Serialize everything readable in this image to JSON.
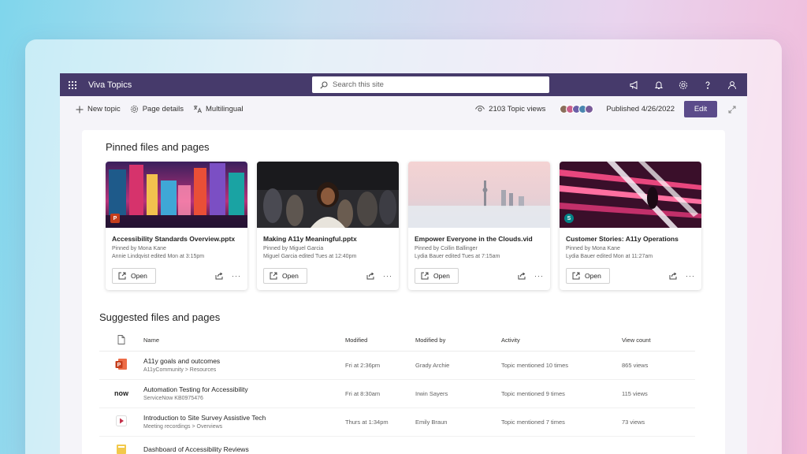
{
  "app": {
    "title": "Viva Topics"
  },
  "search": {
    "placeholder": "Search this site"
  },
  "commandbar": {
    "new_topic": "New topic",
    "page_details": "Page details",
    "multilingual": "Multilingual",
    "views": "2103 Topic views",
    "published": "Published 4/26/2022",
    "edit": "Edit"
  },
  "pinned": {
    "title": "Pinned files and pages",
    "cards": [
      {
        "title": "Accessibility Standards Overview.pptx",
        "pinned_by": "Pinned by Mona Kane",
        "edited": "Annie Lindqvist edited Mon at 3:15pm",
        "open": "Open",
        "badge": "P",
        "badge_color": "#c43e1c"
      },
      {
        "title": "Making A11y Meaningful.pptx",
        "pinned_by": "Pinned by Miguel Garcia",
        "edited": "Miguel Garcia edited Tues at 12:40pm",
        "open": "Open",
        "badge": "",
        "badge_color": ""
      },
      {
        "title": "Empower Everyone in the Clouds.vid",
        "pinned_by": "Pinned by Collin Ballinger",
        "edited": "Lydia Bauer edited Tues at 7:15am",
        "open": "Open",
        "badge": "",
        "badge_color": ""
      },
      {
        "title": "Customer Stories: A11y Operations",
        "pinned_by": "Pinned by Mona Kane",
        "edited": "Lydia Bauer edited Mon at 11:27am",
        "open": "Open",
        "badge": "S",
        "badge_color": "#038387"
      }
    ]
  },
  "suggested": {
    "title": "Suggested files and pages",
    "columns": {
      "name": "Name",
      "modified": "Modified",
      "modified_by": "Modified by",
      "activity": "Activity",
      "view_count": "View count"
    },
    "rows": [
      {
        "icon": "powerpoint-icon",
        "name": "A11y goals and outcomes",
        "path": "A11yCommunity > Resources",
        "modified": "Fri at 2:36pm",
        "modified_by": "Grady Archie",
        "activity": "Topic mentioned 10 times",
        "views": "865 views"
      },
      {
        "icon": "servicenow-icon",
        "icon_text": "now",
        "name": "Automation Testing for Accessibility",
        "path": "ServiceNow KB0975476",
        "modified": "Fri at 8:30am",
        "modified_by": "Irwin Sayers",
        "activity": "Topic mentioned 9 times",
        "views": "115 views"
      },
      {
        "icon": "video-icon",
        "name": "Introduction to Site Survey Assistive Tech",
        "path": "Meeting recordings > Overviews",
        "modified": "Thurs at 1:34pm",
        "modified_by": "Emily Braun",
        "activity": "Topic mentioned 7 times",
        "views": "73 views"
      },
      {
        "icon": "page-icon",
        "name": "Dashboard of Accessibility Reviews",
        "path": "",
        "modified": "",
        "modified_by": "",
        "activity": "",
        "views": ""
      }
    ]
  },
  "colors": {
    "suitebar": "#463a6b",
    "accent": "#5b4b8a"
  }
}
